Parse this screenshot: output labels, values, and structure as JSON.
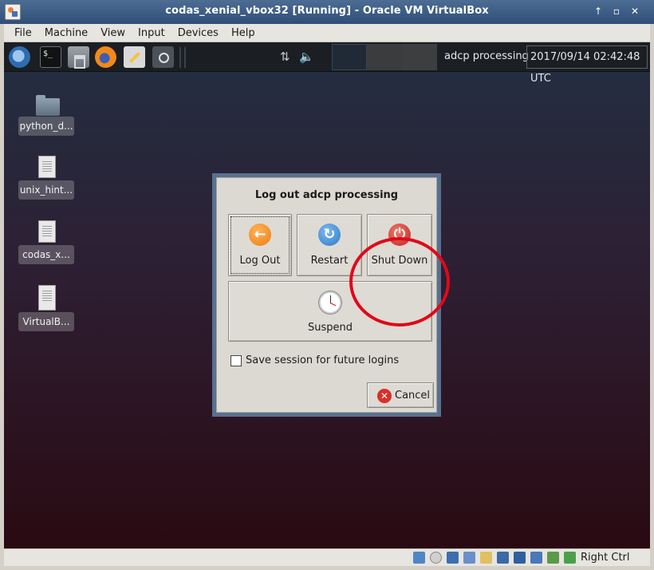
{
  "window": {
    "title": "codas_xenial_vbox32 [Running] - Oracle VM VirtualBox",
    "controls": [
      "↑",
      "▫",
      "✕"
    ]
  },
  "menubar": {
    "items": [
      "File",
      "Machine",
      "View",
      "Input",
      "Devices",
      "Help"
    ]
  },
  "guest_panel": {
    "terminal_glyph": "$_",
    "network_glyph": "⇅",
    "volume_glyph": "🔈",
    "username": "adcp processing",
    "clock": "2017/09/14 02:42:48 UTC"
  },
  "desktop": {
    "icons": [
      {
        "label": "python_d...",
        "kind": "folder-icon"
      },
      {
        "label": "unix_hint...",
        "kind": "document-icon"
      },
      {
        "label": "codas_x...",
        "kind": "document-icon"
      },
      {
        "label": "VirtualB...",
        "kind": "document-icon"
      }
    ]
  },
  "dialog": {
    "title": "Log out adcp processing",
    "log_out": {
      "label": "Log Out",
      "glyph": "←"
    },
    "restart": {
      "label": "Restart",
      "glyph": "↻"
    },
    "shut_down": {
      "label": "Shut Down",
      "glyph": "⏻"
    },
    "suspend": {
      "label": "Suspend"
    },
    "save_session_label": "Save session for future logins",
    "save_session_checked": false,
    "cancel": {
      "label": "Cancel",
      "glyph": "✕"
    }
  },
  "highlight_color": "#e0091a",
  "statusbar": {
    "host_key": "Right Ctrl"
  }
}
